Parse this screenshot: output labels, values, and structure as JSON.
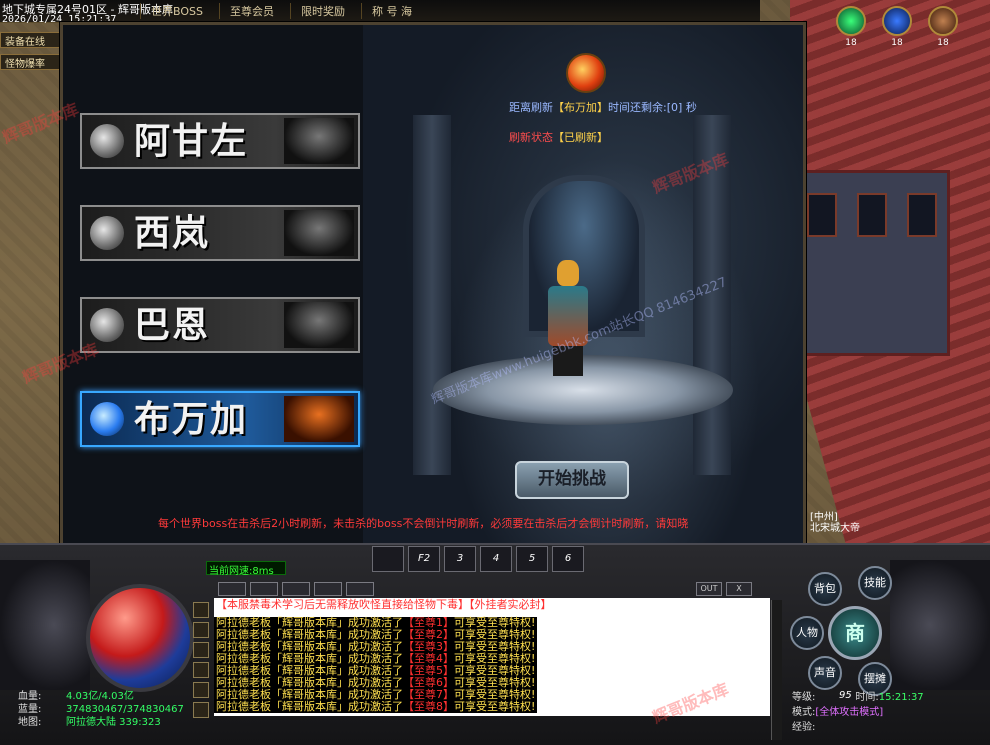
{
  "topbar": {
    "server": "地下城专属24号01区 - 辉哥版本库",
    "datetime": "2026/01/24 15:21:37",
    "nav": [
      "世界BOSS",
      "至尊会员",
      "限时奖励",
      "称 号 海"
    ]
  },
  "side_buttons": [
    "装备在线",
    "怪物爆率"
  ],
  "top_icons": [
    {
      "icon": "green-orb-icon",
      "count": "18"
    },
    {
      "icon": "shield-icon",
      "count": "18"
    },
    {
      "icon": "bag-icon",
      "count": "18"
    }
  ],
  "dialog": {
    "bosses": [
      {
        "name": "阿甘左",
        "selected": false
      },
      {
        "name": "西岚",
        "selected": false
      },
      {
        "name": "巴恩",
        "selected": false
      },
      {
        "name": "布万加",
        "selected": true
      }
    ],
    "refresh_prefix": "距离刷新",
    "refresh_boss": "【布万加】",
    "refresh_suffix": "时间还剩余:",
    "refresh_value": "[0]",
    "refresh_unit": "秒",
    "status_prefix": "刷新状态",
    "status_value": "【已刷新】",
    "start_button": "开始挑战",
    "notice": "每个世界boss在击杀后2小时刷新，未击杀的boss不会倒计时刷新，必须要在击杀后才会倒计时刷新，请知晓"
  },
  "hud": {
    "network": "当前网速:8ms",
    "skill_slots": [
      "",
      "F2",
      "3",
      "4",
      "5",
      "6"
    ],
    "chat_right_tabs": [
      "OUT",
      "X"
    ],
    "chat_header": "【本服禁毒术学习后无需释放吹怪直接给怪物下毒】【外挂者实必封】",
    "chat_lines": [
      {
        "a": "阿拉德老板「辉哥版本库」成功激活了",
        "b": "【至尊1】",
        "c": "可享受至尊特权!"
      },
      {
        "a": "阿拉德老板「辉哥版本库」成功激活了",
        "b": "【至尊2】",
        "c": "可享受至尊特权!"
      },
      {
        "a": "阿拉德老板「辉哥版本库」成功激活了",
        "b": "【至尊3】",
        "c": "可享受至尊特权!"
      },
      {
        "a": "阿拉德老板「辉哥版本库」成功激活了",
        "b": "【至尊4】",
        "c": "可享受至尊特权!"
      },
      {
        "a": "阿拉德老板「辉哥版本库」成功激活了",
        "b": "【至尊5】",
        "c": "可享受至尊特权!"
      },
      {
        "a": "阿拉德老板「辉哥版本库」成功激活了",
        "b": "【至尊6】",
        "c": "可享受至尊特权!"
      },
      {
        "a": "阿拉德老板「辉哥版本库」成功激活了",
        "b": "【至尊7】",
        "c": "可享受至尊特权!"
      },
      {
        "a": "阿拉德老板「辉哥版本库」成功激活了",
        "b": "【至尊8】",
        "c": "可享受至尊特权!"
      }
    ],
    "stats": [
      {
        "label": "血量:",
        "value": "4.03亿/4.03亿"
      },
      {
        "label": "蓝量:",
        "value": "374830467/374830467"
      },
      {
        "label": "地图:",
        "value": "阿拉德大陆 339:323"
      }
    ],
    "right_buttons": {
      "bag": "背包",
      "skill": "技能",
      "character": "人物",
      "shop": "商",
      "sound": "声音",
      "stall": "摆摊"
    },
    "level_label": "等级:",
    "level_value": "95",
    "time_label": "时间:",
    "time_value": "15:21:37",
    "mode_label": "模式:",
    "mode_value": "[全体攻击模式]",
    "exp_label": "经验:"
  },
  "npc_label": "[中州]\n北宋城大帝",
  "watermarks": [
    "辉哥版本库",
    "辉哥版本库www.huigebbk.com站长QQ 814634227"
  ]
}
